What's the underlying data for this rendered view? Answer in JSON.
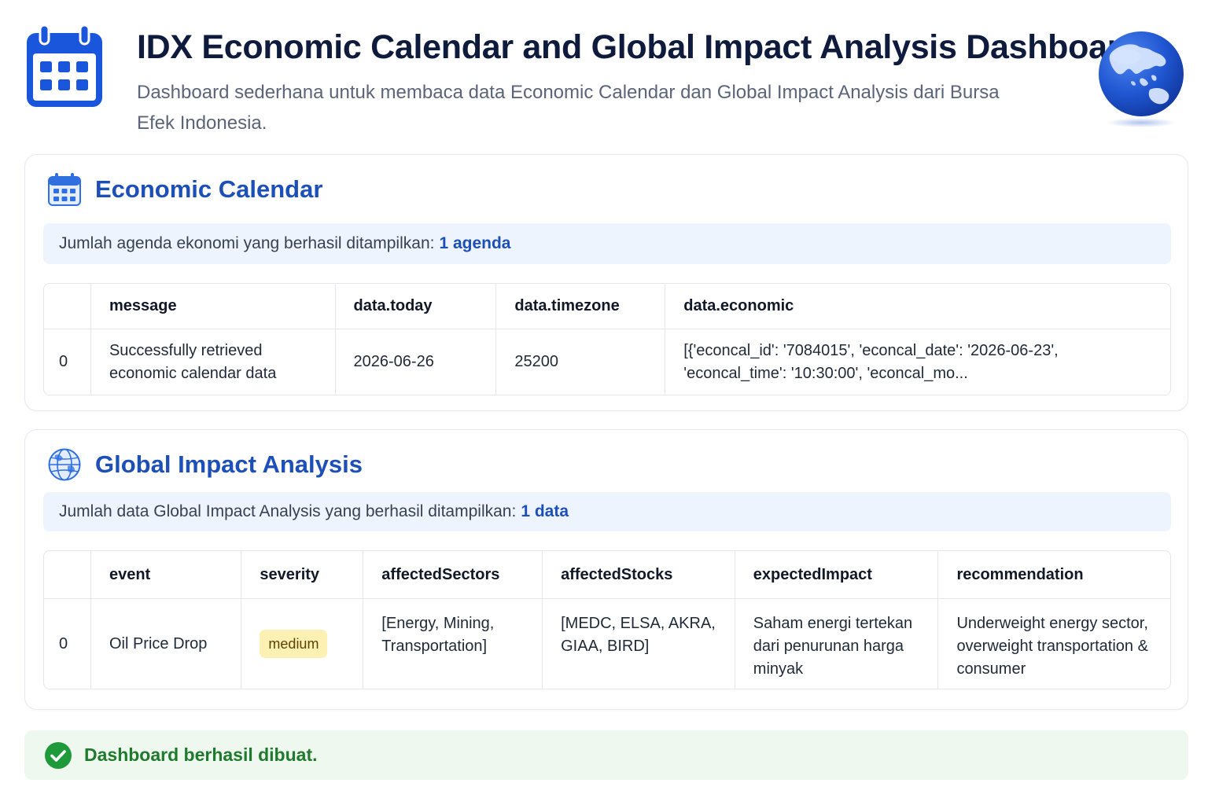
{
  "header": {
    "title": "IDX Economic Calendar and Global Impact Analysis Dashboard",
    "subtitle": "Dashboard sederhana untuk membaca data Economic Calendar dan Global Impact Analysis dari Bursa Efek Indonesia.",
    "calendar_icon": "calendar-icon",
    "globe_icon": "globe-icon"
  },
  "colors": {
    "accent": "#1d4fb8",
    "icon_blue": "#1a56db",
    "info_bg": "#eef4fd",
    "success_bg": "#eef8ef",
    "success_text": "#1f7a2e",
    "badge_bg": "#fdf0b3"
  },
  "economic_calendar": {
    "title": "Economic Calendar",
    "icon": "calendar-icon",
    "info_text": "Jumlah agenda ekonomi yang berhasil ditampilkan:",
    "count": "1 agenda",
    "columns": [
      "",
      "message",
      "data.today",
      "data.timezone",
      "data.economic"
    ],
    "rows": [
      {
        "index": "0",
        "message": "Successfully retrieved economic calendar data",
        "today": "2026-06-26",
        "timezone": "25200",
        "economic": "[{'econcal_id': '7084015', 'econcal_date': '2026-06-23', 'econcal_time': '10:30:00', 'econcal_mo..."
      }
    ]
  },
  "global_impact": {
    "title": "Global Impact Analysis",
    "icon": "globe-icon",
    "info_text": "Jumlah data Global Impact Analysis yang berhasil ditampilkan:",
    "count": "1 data",
    "columns": [
      "",
      "event",
      "severity",
      "affectedSectors",
      "affectedStocks",
      "expectedImpact",
      "recommendation"
    ],
    "rows": [
      {
        "index": "0",
        "event": "Oil Price Drop",
        "severity": "medium",
        "affectedSectors": "[Energy, Mining, Transportation]",
        "affectedStocks": "[MEDC, ELSA, AKRA, GIAA, BIRD]",
        "expectedImpact": "Saham energi tertekan dari penurunan harga minyak",
        "recommendation": "Underweight energy sector, overweight transportation & consumer"
      }
    ]
  },
  "status": {
    "icon": "check-circle-icon",
    "message": "Dashboard berhasil dibuat."
  }
}
